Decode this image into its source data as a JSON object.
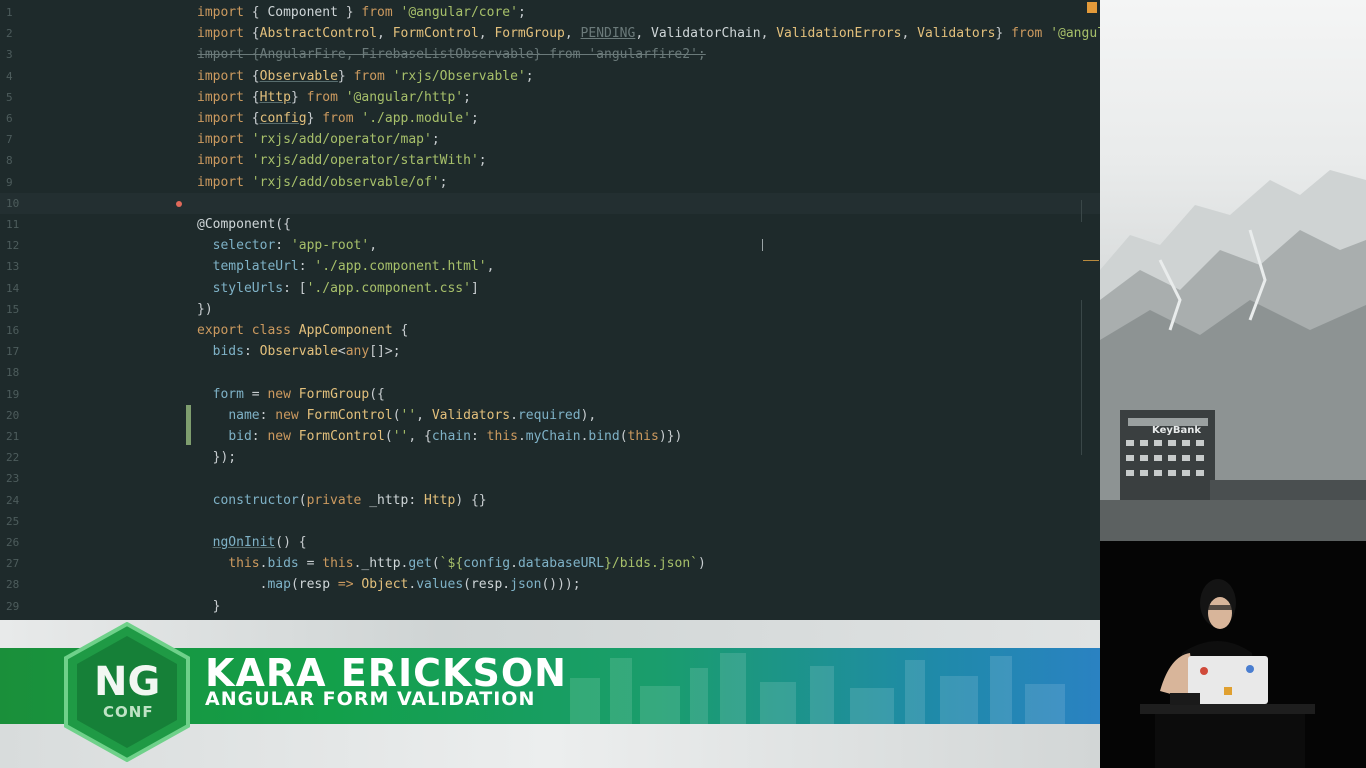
{
  "editor": {
    "lines": [
      {
        "n": "1",
        "html": "<span class='k'>import</span> { <span class='d'>Component</span> } <span class='k'>from</span> <span class='s'>'@angular/core'</span>;"
      },
      {
        "n": "2",
        "html": "<span class='k'>import</span> {<span class='t'>AbstractControl</span>, <span class='t'>FormControl</span>, <span class='t'>FormGroup</span>, <span class='c' style='text-decoration:underline'>PENDING</span>, <span class='d'>ValidatorChain</span>, <span class='t'>ValidationErrors</span>, <span class='t'>Validators</span>} <span class='k'>from</span> <span class='s'>'@angular/fo</span>"
      },
      {
        "n": "3",
        "html": "<span class='c'>import {AngularFire, FirebaseListObservable} from 'angularfire2';</span>"
      },
      {
        "n": "4",
        "html": "<span class='k'>import</span> {<span class='t u'>Observable</span>} <span class='k'>from</span> <span class='s'>'rxjs/Observable'</span>;"
      },
      {
        "n": "5",
        "html": "<span class='k'>import</span> {<span class='t u'>Http</span>} <span class='k'>from</span> <span class='s'>'@angular/http'</span>;"
      },
      {
        "n": "6",
        "html": "<span class='k'>import</span> {<span class='t u'>config</span>} <span class='k'>from</span> <span class='s'>'./app.module'</span>;"
      },
      {
        "n": "7",
        "html": "<span class='k'>import</span> <span class='s'>'rxjs/add/operator/map'</span>;"
      },
      {
        "n": "8",
        "html": "<span class='k'>import</span> <span class='s'>'rxjs/add/operator/startWith'</span>;"
      },
      {
        "n": "9",
        "html": "<span class='k'>import</span> <span class='s'>'rxjs/add/observable/of'</span>;"
      },
      {
        "n": "10",
        "html": ""
      },
      {
        "n": "11",
        "html": "<span class='d'>@Component</span>({"
      },
      {
        "n": "12",
        "html": "  <span class='p'>selector</span>: <span class='s'>'app-root'</span>,"
      },
      {
        "n": "13",
        "html": "  <span class='p'>templateUrl</span>: <span class='s'>'./app.component.html'</span>,"
      },
      {
        "n": "14",
        "html": "  <span class='p'>styleUrls</span>: [<span class='s'>'./app.component.css'</span>]"
      },
      {
        "n": "15",
        "html": "})"
      },
      {
        "n": "16",
        "html": "<span class='k'>export class</span> <span class='t'>AppComponent</span> {"
      },
      {
        "n": "17",
        "html": "  <span class='p'>bids</span>: <span class='t'>Observable</span>&lt;<span class='k'>any</span>[]&gt;;"
      },
      {
        "n": "18",
        "html": ""
      },
      {
        "n": "19",
        "html": "  <span class='p'>form</span> = <span class='k'>new</span> <span class='t'>FormGroup</span>({"
      },
      {
        "n": "20",
        "html": "    <span class='p'>name</span>: <span class='k'>new</span> <span class='t'>FormControl</span>(<span class='s'>''</span>, <span class='t'>Validators</span>.<span class='p'>required</span>),"
      },
      {
        "n": "21",
        "html": "    <span class='p'>bid</span>: <span class='k'>new</span> <span class='t'>FormControl</span>(<span class='s'>''</span>, {<span class='p'>chain</span>: <span class='k'>this</span>.<span class='p'>myChain</span>.<span class='p'>bind</span>(<span class='k'>this</span>)})"
      },
      {
        "n": "22",
        "html": "  });"
      },
      {
        "n": "23",
        "html": ""
      },
      {
        "n": "24",
        "html": "  <span class='p'>constructor</span>(<span class='k'>private</span> <span class='d'>_http</span>: <span class='t'>Http</span>) {}"
      },
      {
        "n": "25",
        "html": ""
      },
      {
        "n": "26",
        "html": "  <span class='p u'>ngOnInit</span>() {"
      },
      {
        "n": "27",
        "html": "    <span class='k'>this</span>.<span class='p'>bids</span> = <span class='k'>this</span>.<span class='d'>_http</span>.<span class='p'>get</span>(<span class='s'>`${</span><span class='p'>config</span>.<span class='p'>databaseURL</span><span class='s'>}/bids.json`</span>)"
      },
      {
        "n": "28",
        "html": "        .<span class='p'>map</span>(<span class='d'>resp</span> <span class='k'>=&gt;</span> <span class='t'>Object</span>.<span class='p'>values</span>(<span class='d'>resp</span>.<span class='p'>json</span>()));"
      },
      {
        "n": "29",
        "html": "  }"
      }
    ]
  },
  "lower_third": {
    "speaker_name": "KARA ERICKSON",
    "talk_title": "ANGULAR FORM VALIDATION",
    "logo_main": "NG",
    "logo_sub": "CONF"
  },
  "photo": {
    "building_sign": "KeyBank"
  }
}
